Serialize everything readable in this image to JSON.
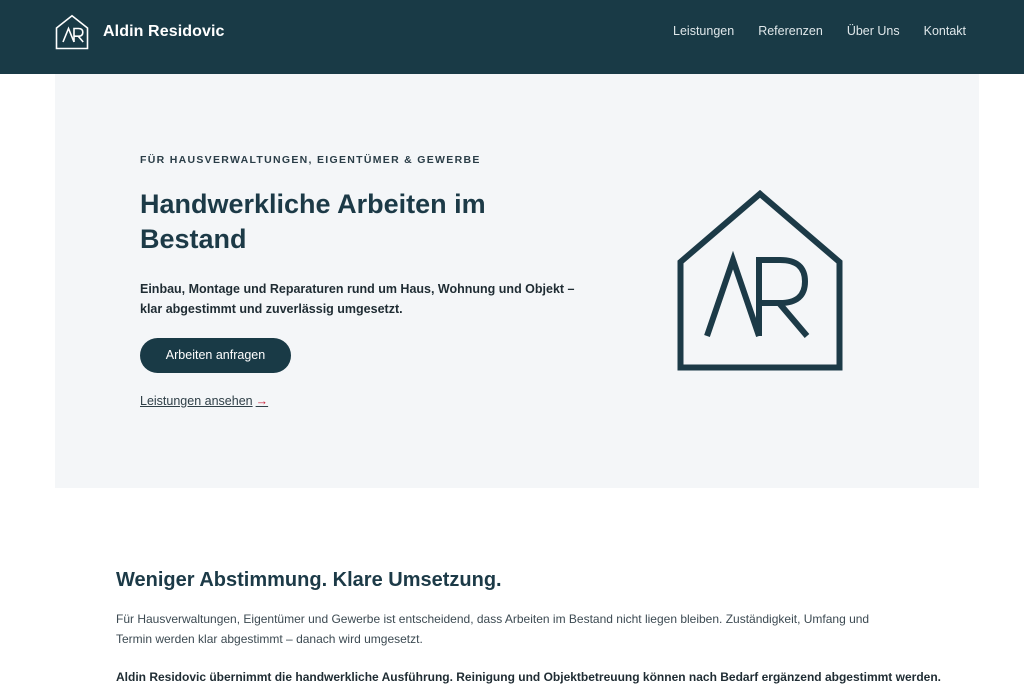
{
  "colors": {
    "brand_dark": "#193a46",
    "hero_background": "#f4f6f8",
    "accent_arrow": "#c8233c"
  },
  "header": {
    "logo_icon": "house-monogram-logo-icon",
    "brand_name": "Aldin Residovic",
    "nav": [
      {
        "label": "Leistungen"
      },
      {
        "label": "Referenzen"
      },
      {
        "label": "Über Uns"
      },
      {
        "label": "Kontakt"
      }
    ]
  },
  "hero": {
    "eyebrow": "FÜR HAUSVERWALTUNGEN, EIGENTÜMER & GEWERBE",
    "title": "Handwerkliche Arbeiten im Bestand",
    "lead": "Einbau, Montage und Reparaturen rund um Haus, Wohnung und Objekt – klar abgestimmt und zuverlässig umgesetzt.",
    "cta_label": "Arbeiten anfragen",
    "secondary_link_label": "Leistungen ansehen",
    "secondary_link_arrow": "→",
    "logo_icon": "house-monogram-logo-icon"
  },
  "intro": {
    "title": "Weniger Abstimmung. Klare Umsetzung.",
    "text": "Für Hausverwaltungen, Eigentümer und Gewerbe ist entscheidend, dass Arbeiten im Bestand nicht liegen bleiben. Zuständigkeit, Umfang und Termin werden klar abgestimmt – danach wird umgesetzt.",
    "strong_text": "Aldin Residovic übernimmt die handwerkliche Ausführung. Reinigung und Objektbetreuung können nach Bedarf ergänzend abgestimmt werden."
  }
}
